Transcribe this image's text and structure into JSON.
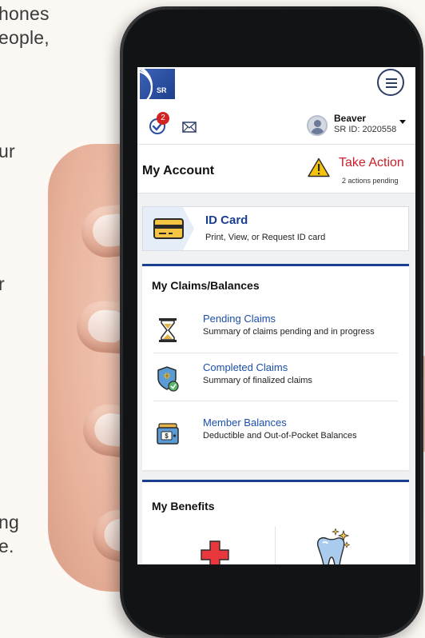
{
  "background_text": {
    "line1": "hones",
    "line2": "eople,",
    "line3": "ur",
    "line4": "r",
    "line5": "ng",
    "line6": "e."
  },
  "header": {
    "logo_text": "SR",
    "menu_icon": "hamburger-menu-icon"
  },
  "subheader": {
    "task_badge": "2",
    "user_name": "Beaver",
    "user_id": "SR ID: 2020558"
  },
  "account": {
    "title": "My Account",
    "take_action_label": "Take Action",
    "pending_text": "2 actions pending"
  },
  "id_card": {
    "title": "ID Card",
    "subtitle": "Print, View, or Request ID card"
  },
  "claims": {
    "section_title": "My Claims/Balances",
    "items": [
      {
        "title": "Pending Claims",
        "subtitle": "Summary of claims pending and in progress",
        "icon": "hourglass-icon"
      },
      {
        "title": "Completed Claims",
        "subtitle": "Summary of finalized claims",
        "icon": "shield-check-icon"
      },
      {
        "title": "Member Balances",
        "subtitle": "Deductible and Out-of-Pocket Balances",
        "icon": "wallet-icon"
      }
    ]
  },
  "benefits": {
    "section_title": "My Benefits"
  },
  "colors": {
    "brand_blue": "#1b3f8f",
    "link_blue": "#1b4faa",
    "alert_red": "#c8202a",
    "warning_yellow": "#f5c20f"
  }
}
